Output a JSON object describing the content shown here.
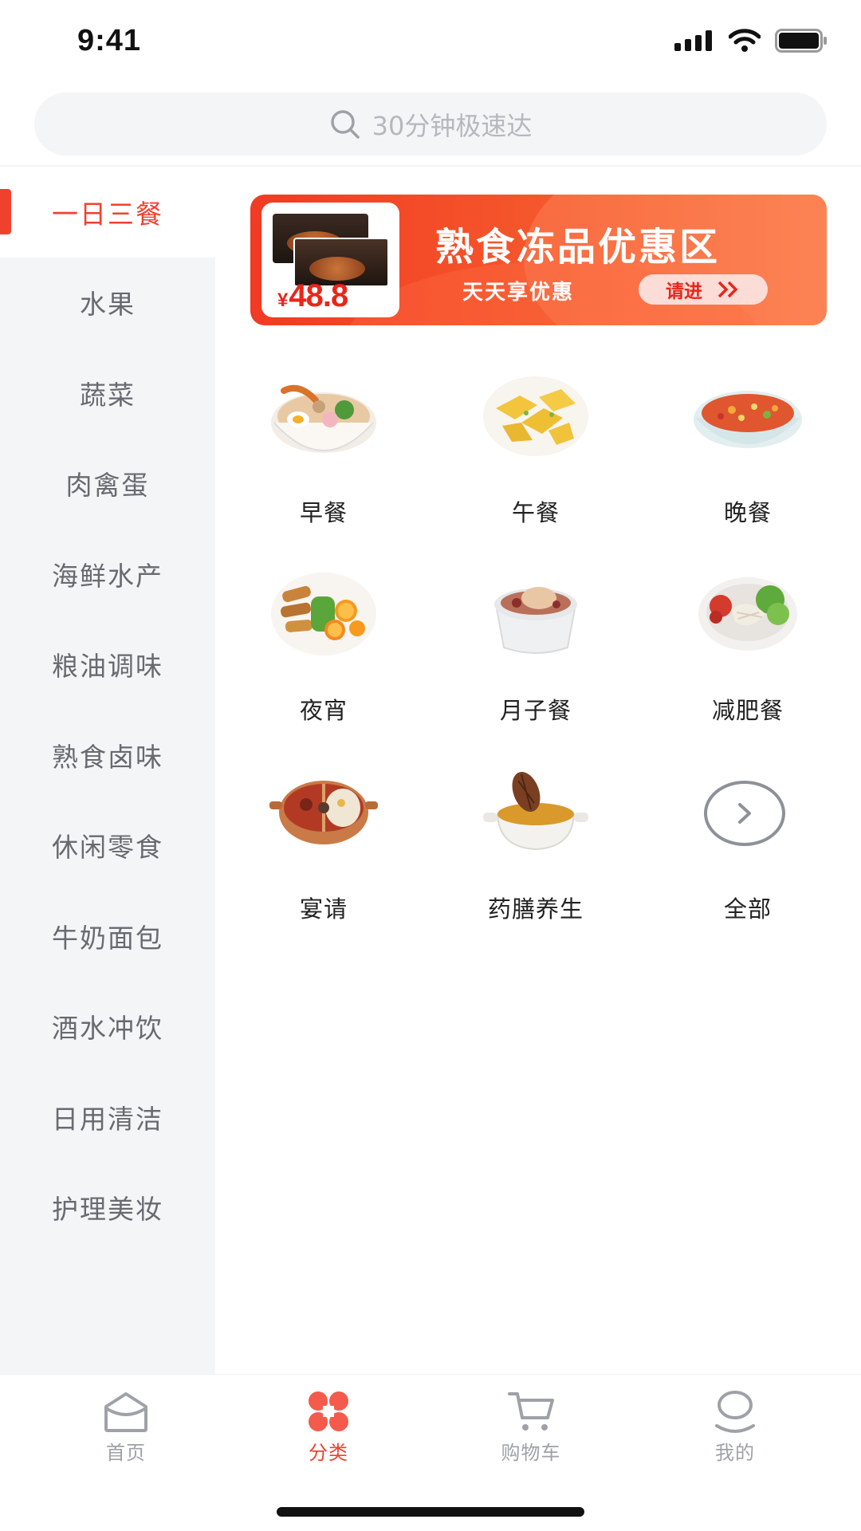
{
  "status_bar": {
    "time": "9:41"
  },
  "search": {
    "placeholder": "30分钟极速达"
  },
  "sidebar": {
    "items": [
      {
        "label": "一日三餐",
        "active": true
      },
      {
        "label": "水果"
      },
      {
        "label": "蔬菜"
      },
      {
        "label": "肉禽蛋"
      },
      {
        "label": "海鲜水产"
      },
      {
        "label": "粮油调味"
      },
      {
        "label": "熟食卤味"
      },
      {
        "label": "休闲零食"
      },
      {
        "label": "牛奶面包"
      },
      {
        "label": "酒水冲饮"
      },
      {
        "label": "日用清洁"
      },
      {
        "label": "护理美妆"
      }
    ]
  },
  "banner": {
    "title": "熟食冻品优惠区",
    "subtitle": "天天享优惠",
    "button_label": "请进",
    "price_symbol": "¥",
    "price": "48.8"
  },
  "categories": [
    {
      "label": "早餐",
      "icon": "ramen-bowl-icon"
    },
    {
      "label": "午餐",
      "icon": "chicken-plate-icon"
    },
    {
      "label": "晚餐",
      "icon": "stir-fry-bowl-icon"
    },
    {
      "label": "夜宵",
      "icon": "grilled-platter-icon"
    },
    {
      "label": "月子餐",
      "icon": "soup-pot-icon"
    },
    {
      "label": "减肥餐",
      "icon": "salad-plate-icon"
    },
    {
      "label": "宴请",
      "icon": "hotpot-icon"
    },
    {
      "label": "药膳养生",
      "icon": "herbal-soup-icon"
    },
    {
      "label": "全部",
      "icon": "chevron-right-circle-icon"
    }
  ],
  "tabbar": {
    "items": [
      {
        "label": "首页",
        "icon": "home-icon"
      },
      {
        "label": "分类",
        "icon": "category-icon",
        "active": true
      },
      {
        "label": "购物车",
        "icon": "cart-icon"
      },
      {
        "label": "我的",
        "icon": "profile-icon"
      }
    ]
  },
  "colors": {
    "accent": "#f0412f",
    "sidebar_bg": "#f4f5f7",
    "search_bg": "#f4f5f7"
  }
}
